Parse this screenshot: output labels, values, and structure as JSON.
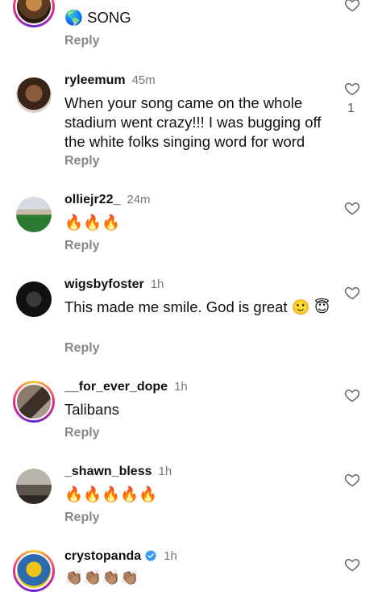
{
  "comments": [
    {
      "username": "",
      "time": "",
      "text": "🌎 SONG",
      "reply": "Reply",
      "likes": ""
    },
    {
      "username": "ryleemum",
      "time": "45m",
      "text": "When your song came on the whole stadium went crazy!!! I was bugging off the white folks singing word for word",
      "reply": "Reply",
      "likes": "1"
    },
    {
      "username": "olliejr22_",
      "time": "24m",
      "text": "🔥🔥🔥",
      "reply": "Reply",
      "likes": ""
    },
    {
      "username": "wigsbyfoster",
      "time": "1h",
      "text": "This made me smile. God is great 🙂 😇",
      "reply": "Reply",
      "likes": ""
    },
    {
      "username": "__for_ever_dope",
      "time": "1h",
      "text": "Talibans",
      "reply": "Reply",
      "likes": ""
    },
    {
      "username": "_shawn_bless",
      "time": "1h",
      "text": "🔥🔥🔥🔥🔥",
      "reply": "Reply",
      "likes": ""
    },
    {
      "username": "crystopanda",
      "time": "1h",
      "text": "👏🏽👏🏽👏🏽👏🏽",
      "reply": "",
      "likes": ""
    }
  ],
  "icons": {
    "heart": "heart-outline-icon",
    "verified": "verified-badge-icon"
  },
  "colors": {
    "secondary_text": "#777777",
    "verified_blue": "#3897f0",
    "story_ring": [
      "#f9ce34",
      "#ee2a7b",
      "#6228d7"
    ]
  }
}
